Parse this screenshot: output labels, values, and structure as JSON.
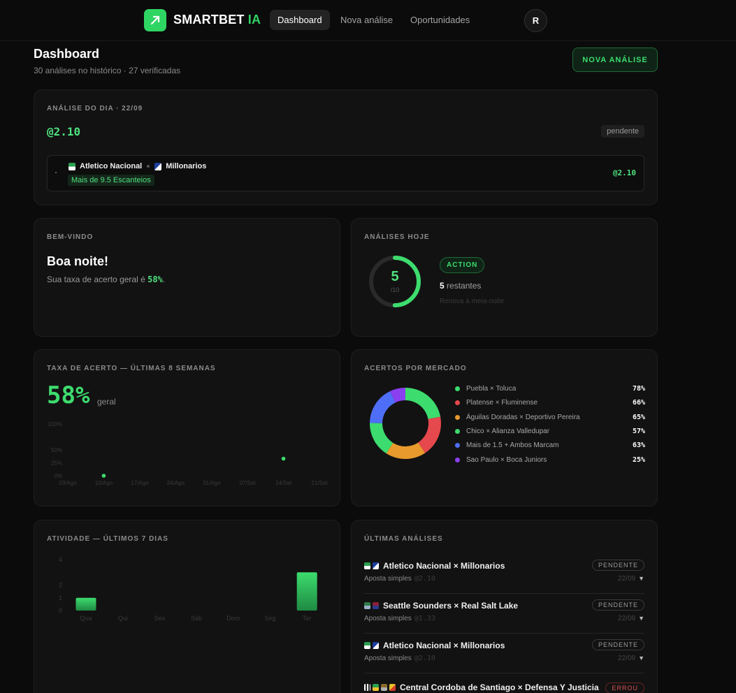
{
  "topbar": {
    "brand_main": "SMARTBET",
    "brand_accent": "IA",
    "nav": [
      "Dashboard",
      "Nova análise",
      "Oportunidades"
    ],
    "avatar_initial": "R",
    "logo_icon": "trend-arrow-icon"
  },
  "header": {
    "title": "Dashboard",
    "subtitle": "30 análises no histórico · 27 verificadas",
    "new_button": "NOVA ANÁLISE"
  },
  "day_analysis": {
    "label": "ANÁLISE DO DIA · 22/09",
    "odd": "@2.10",
    "status": "pendente",
    "home": "Atletico Nacional",
    "away": "Millonarios",
    "market": "Mais de 9.5 Escanteios",
    "match_odd": "@2.10"
  },
  "welcome": {
    "label": "BEM-VINDO",
    "greeting": "Boa noite!",
    "rate_prefix": "Sua taxa de acerto geral é ",
    "rate_value": "58%",
    "rate_suffix": "."
  },
  "today": {
    "label": "ANÁLISES HOJE",
    "used": "5",
    "total": "/10",
    "used_fraction": 0.5,
    "badge": "ACTION",
    "remaining_num": "5",
    "remaining_text": " restantes",
    "renew": "Renova à meia-noite"
  },
  "rate_card": {
    "label": "TAXA DE ACERTO — ÚLTIMAS 8 SEMANAS",
    "big": "58%",
    "big_sub": "geral"
  },
  "market_card": {
    "label": "ACERTOS POR MERCADO"
  },
  "activity_card": {
    "label": "ATIVIDADE — ÚLTIMOS 7 DIAS"
  },
  "latest": {
    "label": "ÚLTIMAS ANÁLISES",
    "items": [
      {
        "title": "Atletico Nacional × Millonarios",
        "type": "Aposta simples",
        "odd": "@2.10",
        "status": "PENDENTE",
        "date": "22/09"
      },
      {
        "title": "Seattle Sounders × Real Salt Lake",
        "type": "Aposta simples",
        "odd": "@1.33",
        "status": "PENDENTE",
        "date": "22/09"
      },
      {
        "title": "Atletico Nacional × Millonarios",
        "type": "Aposta simples",
        "odd": "@2.10",
        "status": "PENDENTE",
        "date": "22/09"
      },
      {
        "title": "Central Cordoba de Santiago × Defensa Y Justicia",
        "type": "",
        "odd": "",
        "status": "ERROU",
        "date": ""
      }
    ],
    "chevron": "▼"
  },
  "colors": {
    "accent": "#3ddc6e",
    "red": "#e5484d",
    "orange": "#e89a2c",
    "blue": "#4f6ef7",
    "purple": "#8a3ff0"
  },
  "chart_data": [
    {
      "type": "scatter",
      "title": "TAXA DE ACERTO — ÚLTIMAS 8 SEMANAS",
      "x": [
        "03/Ago",
        "10/Ago",
        "17/Ago",
        "24/Ago",
        "31/Ago",
        "07/Set",
        "14/Set",
        "21/Set"
      ],
      "yticks": [
        "0%",
        "25%",
        "50%",
        "100%"
      ],
      "ylim": [
        0,
        100
      ],
      "points": [
        {
          "x": "10/Ago",
          "y": 0
        },
        {
          "x": "14/Set",
          "y": 33
        }
      ],
      "grid": false
    },
    {
      "type": "pie",
      "title": "ACERTOS POR MERCADO",
      "donut": true,
      "slices": [
        {
          "name": "Puebla × Toluca",
          "value": 78,
          "label": "78%",
          "color": "#3ddc6e"
        },
        {
          "name": "Platense × Fluminense",
          "value": 66,
          "label": "66%",
          "color": "#e5484d"
        },
        {
          "name": "Águilas Doradas × Deportivo Pereira",
          "value": 65,
          "label": "65%",
          "color": "#e89a2c"
        },
        {
          "name": "Chico × Alianza Valledupar",
          "value": 57,
          "label": "57%",
          "color": "#3ddc6e"
        },
        {
          "name": "Mais de 1.5 + Ambos Marcam",
          "value": 63,
          "label": "63%",
          "color": "#4f6ef7"
        },
        {
          "name": "Sao Paulo × Boca Juniors",
          "value": 25,
          "label": "25%",
          "color": "#8a3ff0"
        }
      ],
      "legend": "right"
    },
    {
      "type": "bar",
      "title": "ATIVIDADE — ÚLTIMOS 7 DIAS",
      "categories": [
        "Qua",
        "Qui",
        "Sex",
        "Sáb",
        "Dom",
        "Seg",
        "Ter"
      ],
      "values": [
        1,
        0,
        0,
        0,
        0,
        0,
        3
      ],
      "yticks": [
        "0",
        "1",
        "2",
        "4"
      ],
      "ylim": [
        0,
        4
      ]
    }
  ]
}
